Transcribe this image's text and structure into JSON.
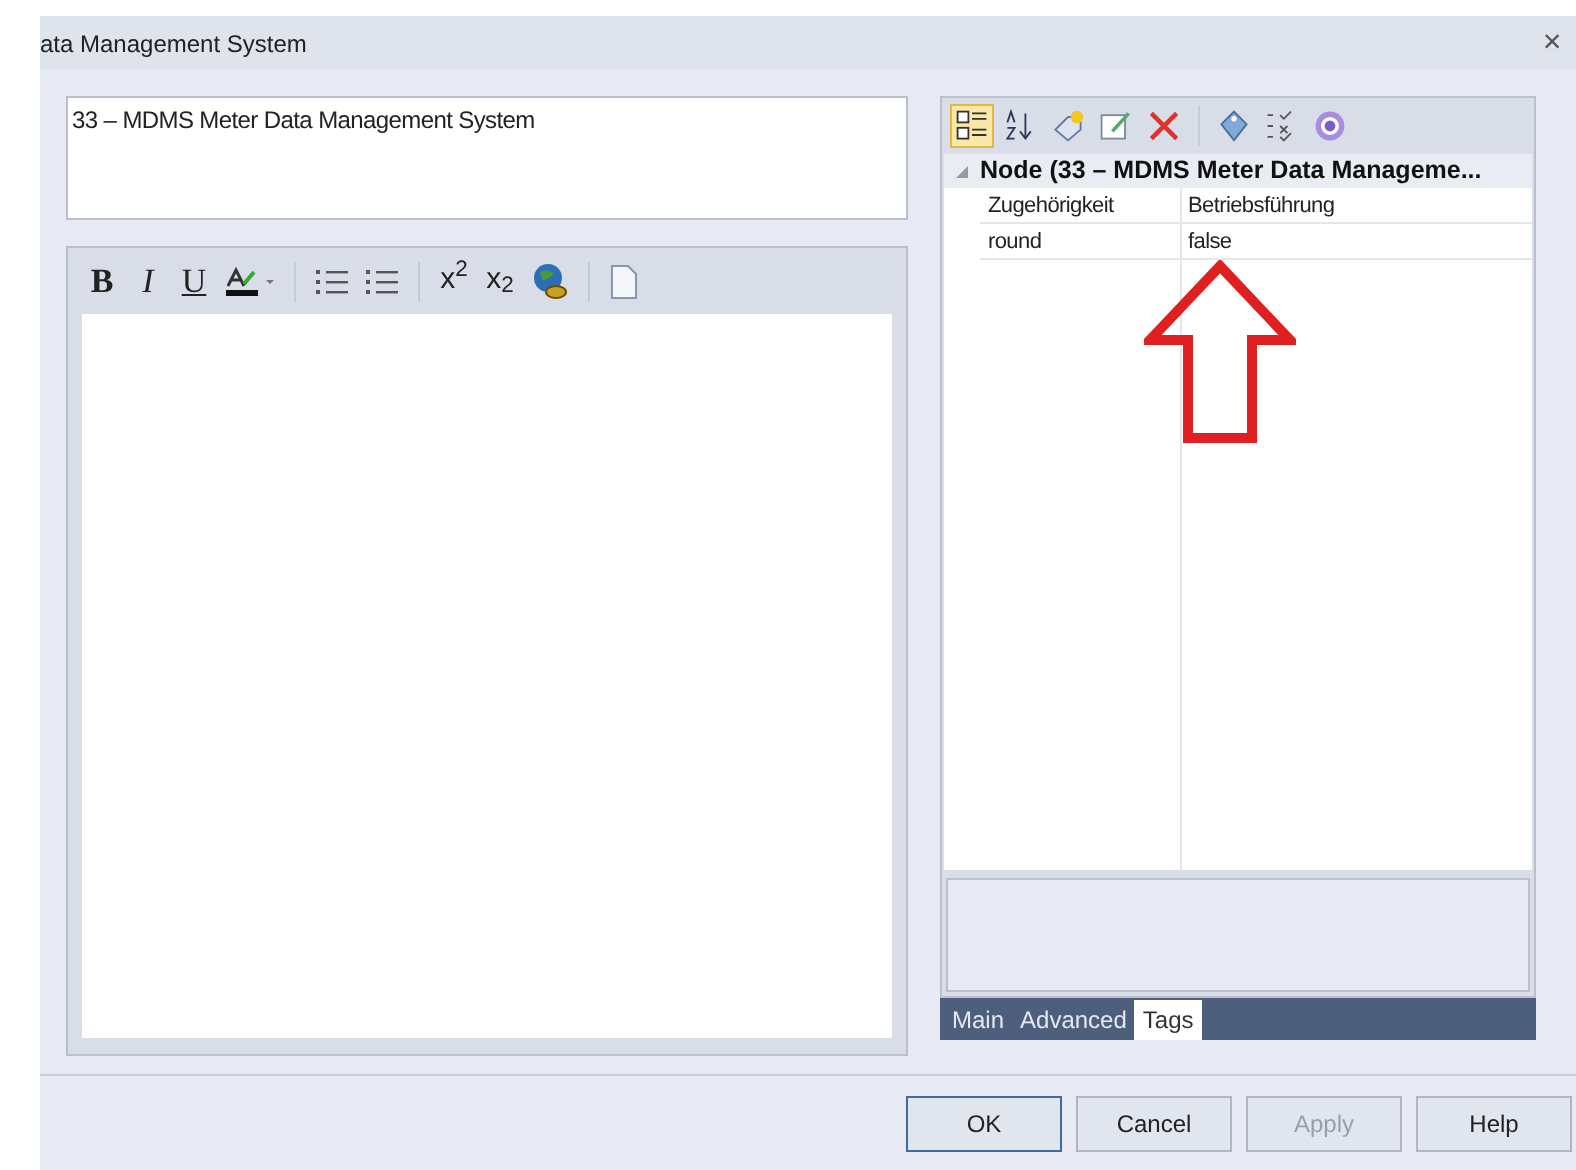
{
  "window": {
    "title": "ata Management System",
    "close": "×"
  },
  "name_field": {
    "value": "33 – MDMS Meter Data Management System"
  },
  "editor_toolbar": [
    {
      "kind": "bold",
      "label": "B"
    },
    {
      "kind": "italic",
      "label": "I"
    },
    {
      "kind": "underline",
      "label": "U"
    },
    {
      "kind": "color"
    },
    {
      "kind": "sep"
    },
    {
      "kind": "bullets"
    },
    {
      "kind": "numbers"
    },
    {
      "kind": "sep"
    },
    {
      "kind": "script",
      "label": "x$^{2}$"
    },
    {
      "kind": "script",
      "label": "x$_{2}$"
    },
    {
      "kind": "globe"
    },
    {
      "kind": "sep"
    },
    {
      "kind": "page"
    }
  ],
  "property_toolbar": [
    {
      "kind": "categorized",
      "selected": true
    },
    {
      "kind": "sort",
      "selected": false
    },
    {
      "kind": "add",
      "selected": false
    },
    {
      "kind": "edit",
      "selected": false
    },
    {
      "kind": "delete",
      "selected": false
    },
    {
      "kind": "sep"
    },
    {
      "kind": "tag",
      "selected": false
    },
    {
      "kind": "list",
      "selected": false
    },
    {
      "kind": "help",
      "selected": false
    }
  ],
  "properties": {
    "title": "Node (33 – MDMS Meter Data Manageme...",
    "expanded": true,
    "rows": [
      {
        "name": "Zugehörigkeit",
        "value": "Betriebsführung"
      },
      {
        "name": "round",
        "value": "false"
      }
    ]
  },
  "tabs": [
    {
      "label": "Main",
      "selected": false
    },
    {
      "label": "Advanced",
      "selected": false
    },
    {
      "label": "Tags",
      "selected": true
    }
  ],
  "buttons": [
    {
      "label": "OK",
      "default": true,
      "disabled": false
    },
    {
      "label": "Cancel",
      "default": false,
      "disabled": false
    },
    {
      "label": "Apply",
      "default": false,
      "disabled": true
    },
    {
      "label": "Help",
      "default": false,
      "disabled": false
    }
  ]
}
